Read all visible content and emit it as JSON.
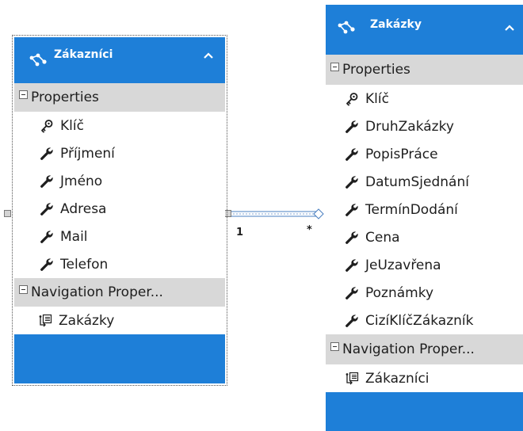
{
  "entities": [
    {
      "title": "Zákazníci",
      "properties_label": "Properties",
      "properties": [
        {
          "name": "Klíč",
          "icon": "key-icon"
        },
        {
          "name": "Příjmení",
          "icon": "wrench-icon"
        },
        {
          "name": "Jméno",
          "icon": "wrench-icon"
        },
        {
          "name": "Adresa",
          "icon": "wrench-icon"
        },
        {
          "name": "Mail",
          "icon": "wrench-icon"
        },
        {
          "name": "Telefon",
          "icon": "wrench-icon"
        }
      ],
      "navigation_label": "Navigation Proper...",
      "navigation": [
        {
          "name": "Zakázky",
          "icon": "navigation-property-icon"
        }
      ]
    },
    {
      "title": "Zakázky",
      "properties_label": "Properties",
      "properties": [
        {
          "name": "Klíč",
          "icon": "key-icon"
        },
        {
          "name": "DruhZakázky",
          "icon": "wrench-icon"
        },
        {
          "name": "PopisPráce",
          "icon": "wrench-icon"
        },
        {
          "name": "DatumSjednání",
          "icon": "wrench-icon"
        },
        {
          "name": "TermínDodání",
          "icon": "wrench-icon"
        },
        {
          "name": "Cena",
          "icon": "wrench-icon"
        },
        {
          "name": "JeUzavřena",
          "icon": "wrench-icon"
        },
        {
          "name": "Poznámky",
          "icon": "wrench-icon"
        },
        {
          "name": "CizíKlíčZákazník",
          "icon": "wrench-icon"
        }
      ],
      "navigation_label": "Navigation Proper...",
      "navigation": [
        {
          "name": "Zákazníci",
          "icon": "navigation-property-icon"
        }
      ]
    }
  ],
  "association": {
    "left_multiplicity": "1",
    "right_multiplicity": "*"
  },
  "colors": {
    "header": "#1e7fd8",
    "section": "#d8d8d8",
    "connector": "#4a7fc0"
  }
}
